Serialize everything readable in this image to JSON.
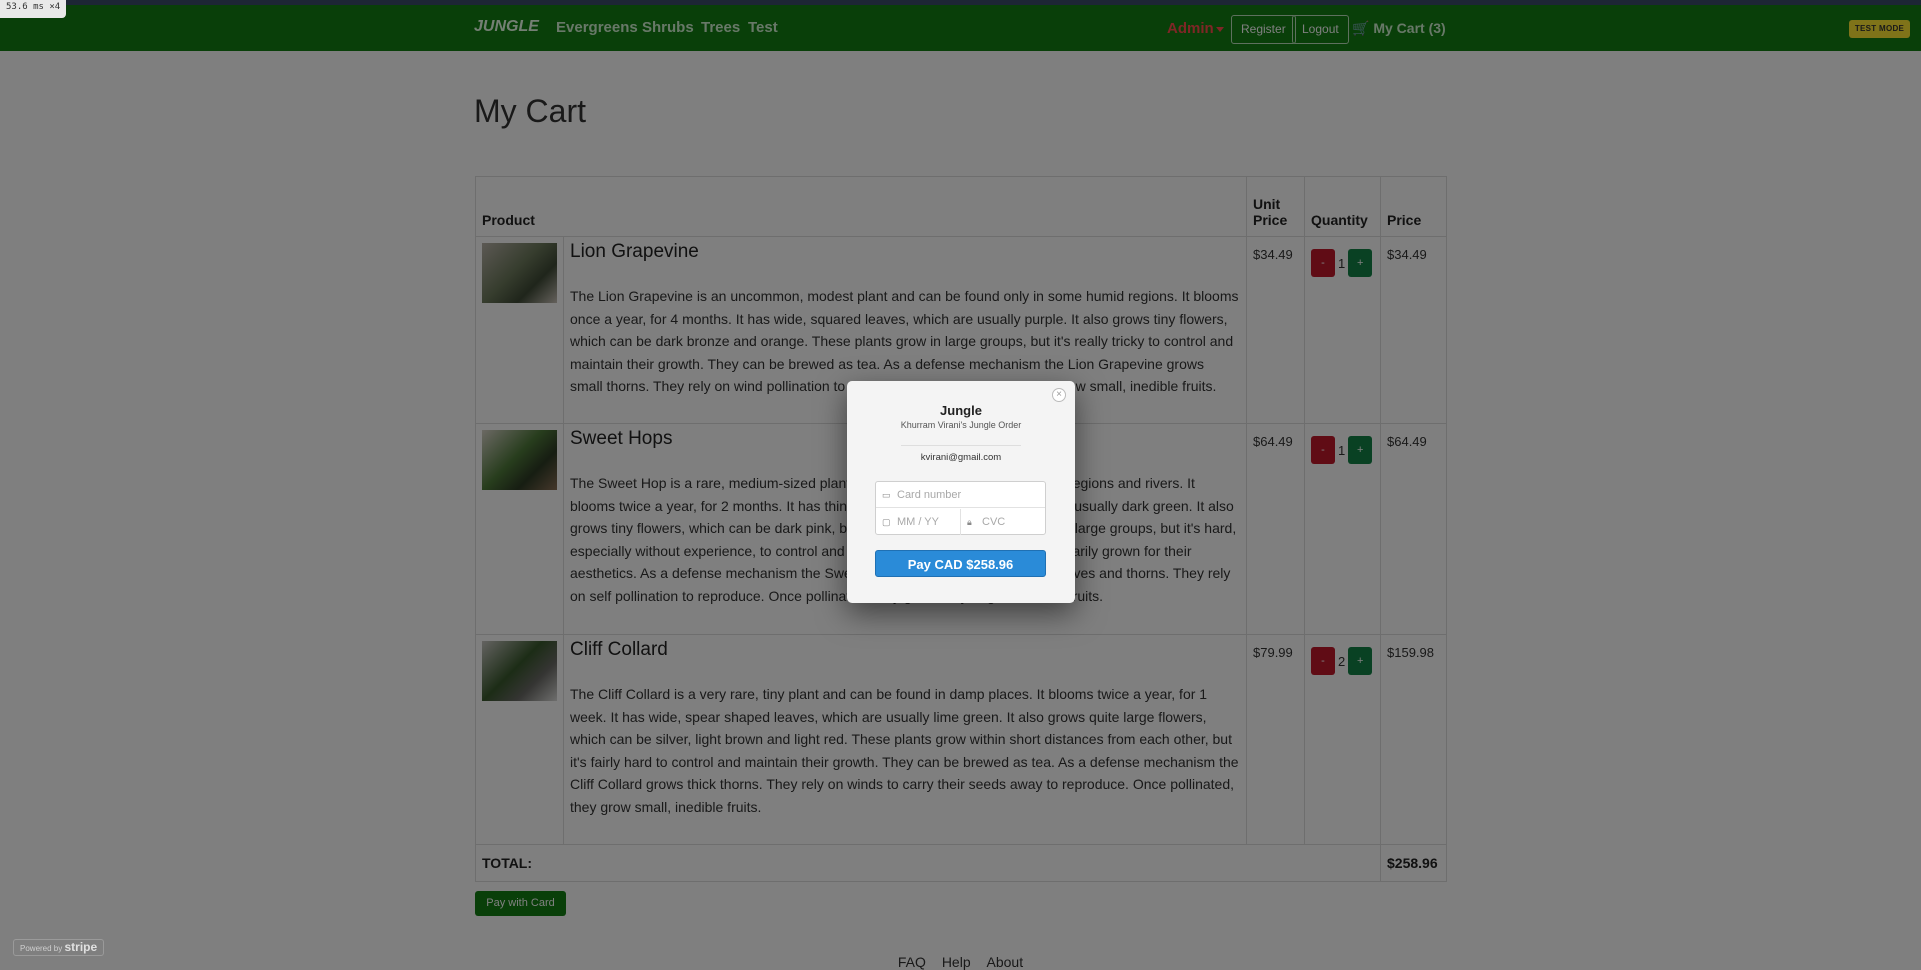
{
  "perf_badge": "53.6 ms ×4",
  "navbar": {
    "brand": "JUNGLE",
    "links": [
      "Evergreens",
      "Shrubs",
      "Trees",
      "Test"
    ],
    "admin_label": "Admin",
    "register_label": "Register",
    "logout_label": "Logout",
    "cart_label": "My Cart (3)"
  },
  "test_mode_badge": "TEST MODE",
  "page": {
    "title": "My Cart",
    "table": {
      "headers": {
        "product": "Product",
        "unit_price": "Unit Price",
        "quantity": "Quantity",
        "price": "Price"
      },
      "rows": [
        {
          "name": "Lion Grapevine",
          "description": "The Lion Grapevine is an uncommon, modest plant and can be found only in some humid regions. It blooms once a year, for 4 months. It has wide, squared leaves, which are usually purple. It also grows tiny flowers, which can be dark bronze and orange. These plants grow in large groups, but it's really tricky to control and maintain their growth. They can be brewed as tea. As a defense mechanism the Lion Grapevine grows small thorns. They rely on wind pollination to reproduce. Once pollinated, they grow small, inedible fruits.",
          "unit_price": "$34.49",
          "quantity": "1",
          "price": "$34.49"
        },
        {
          "name": "Sweet Hops",
          "description": "The Sweet Hop is a rare, medium-sized plant and can be found in many tropical regions and rivers. It blooms twice a year, for 2 months. It has thin, diamond shaped leaves, which are usually dark green. It also grows tiny flowers, which can be dark pink, brown and pink. These plants grow in large groups, but it's hard, especially without experience, to control and maintain their growth. They are primarily grown for their aesthetics. As a defense mechanism the Sweet Hop relies mostly on its tough leaves and thorns. They rely on self pollination to reproduce. Once pollinated, they grow fairly large, delicious fruits.",
          "unit_price": "$64.49",
          "quantity": "1",
          "price": "$64.49"
        },
        {
          "name": "Cliff Collard",
          "description": "The Cliff Collard is a very rare, tiny plant and can be found in damp places. It blooms twice a year, for 1 week. It has wide, spear shaped leaves, which are usually lime green. It also grows quite large flowers, which can be silver, light brown and light red. These plants grow within short distances from each other, but it's fairly hard to control and maintain their growth. They can be brewed as tea. As a defense mechanism the Cliff Collard grows thick thorns. They rely on winds to carry their seeds away to reproduce. Once pollinated, they grow small, inedible fruits.",
          "unit_price": "$79.99",
          "quantity": "2",
          "price": "$159.98"
        }
      ],
      "minus_label": "-",
      "plus_label": "+",
      "total_label": "TOTAL:",
      "total_value": "$258.96"
    },
    "pay_with_card_label": "Pay with Card"
  },
  "footer": {
    "links": [
      "FAQ",
      "Help",
      "About"
    ]
  },
  "stripe_badge": {
    "powered_by": "Powered by",
    "brand": "stripe"
  },
  "checkout_modal": {
    "close_symbol": "×",
    "title": "Jungle",
    "subtitle": "Khurram Virani's Jungle Order",
    "email": "kvirani@gmail.com",
    "card_number_placeholder": "Card number",
    "expiry_placeholder": "MM / YY",
    "cvc_placeholder": "CVC",
    "pay_button_label": "Pay CAD $258.96"
  },
  "colors": {
    "navbar": "#137f13",
    "admin": "#ff4d4d",
    "minus_button": "#c0192b",
    "plus_button": "#138347",
    "pay_button": "#2a8bd8",
    "test_mode": "#ffe633"
  }
}
